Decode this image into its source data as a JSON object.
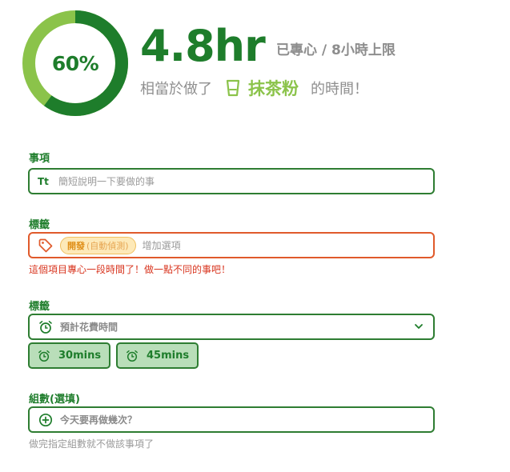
{
  "progress": {
    "percent_label": "60%",
    "fraction": 0.6,
    "hours": "4.8hr",
    "hours_sub": "已專心 / 8小時上限",
    "equiv_prefix": "相當於做了",
    "equiv_item": "抹茶粉",
    "equiv_suffix": "的時間！",
    "colors": {
      "dark": "#1e7d2b",
      "light": "#8bc34a"
    }
  },
  "task": {
    "label": "事項",
    "icon_text": "Tt",
    "placeholder": "簡短說明一下要做的事"
  },
  "tags": {
    "label": "標籤",
    "chip_main": "開發",
    "chip_sub": "(自動偵測)",
    "placeholder": "增加選項",
    "error": "這個項目專心一段時間了！做一點不同的事吧！"
  },
  "time": {
    "label": "標籤",
    "placeholder": "預計花費時間",
    "options": [
      "30mins",
      "45mins"
    ]
  },
  "sets": {
    "label": "組數(選填)",
    "placeholder": "今天要再做幾次？",
    "helper": "做完指定組數就不做該事項了"
  }
}
